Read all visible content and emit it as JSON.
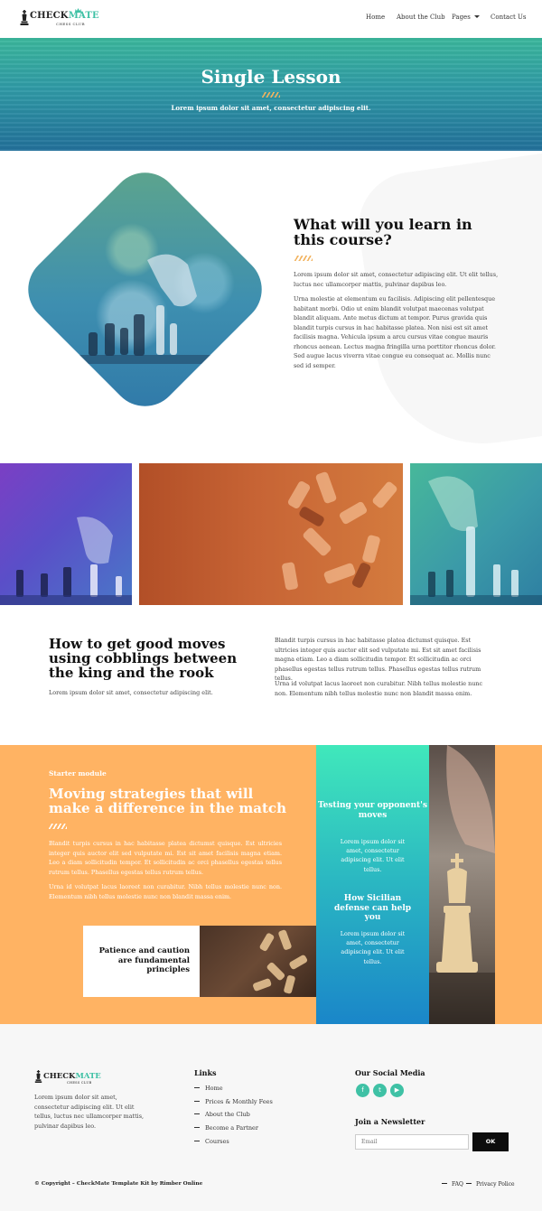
{
  "brand": {
    "name_part1": "CHECK",
    "name_part2": "MATE",
    "tagline": "CHESS CLUB"
  },
  "nav": {
    "items": [
      {
        "label": "Home"
      },
      {
        "label": "About the Club"
      },
      {
        "label": "Pages"
      },
      {
        "label": "Contact Us"
      }
    ]
  },
  "hero": {
    "title": "Single Lesson",
    "subtitle": "Lorem ipsum dolor sit amet, consectetur adipiscing elit."
  },
  "learn": {
    "heading": "What will you learn in this course?",
    "p1": "Lorem ipsum dolor sit amet, consectetur adipiscing elit. Ut elit tellus, luctus nec ullamcorper mattis, pulvinar dapibus leo.",
    "p2": "Urna molestie at elementum eu facilisis. Adipiscing elit pellentesque habitant morbi. Odio ut enim blandit volutpat maecenas volutpat blandit aliquam. Ante metus dictum at tempor. Purus gravida quis blandit turpis cursus in hac habitasse platea. Non nisi est sit amet facilisis magna. Vehicula ipsum a arcu cursus vitae congue mauris rhoncus aenean. Lectus magna fringilla urna porttitor rhoncus dolor. Sed augue lacus viverra vitae congue eu consequat ac. Mollis nunc sed id semper."
  },
  "howto": {
    "heading": "How to get good moves using cobblings between the king and the rook",
    "sub": "Lorem ipsum dolor sit amet, consectetur adipiscing elit.",
    "p1": "Blandit turpis cursus in hac habitasse platea dictumst quisque. Est ultricies integer quis auctor elit sed vulputate mi. Est sit amet facilisis magna etiam. Leo a diam sollicitudin tempor. Et sollicitudin ac orci phasellus egestas tellus rutrum tellus. Phasellus egestas tellus rutrum tellus.",
    "p2": "Urna id volutpat lacus laoreet non curabitur. Nibh tellus molestie nunc non. Elementum nibh tellus molestie nunc non blandit massa enim."
  },
  "module": {
    "kicker": "Starter module",
    "heading": "Moving strategies that will make a difference in the match",
    "p1": "Blandit turpis cursus in hac habitasse platea dictumst quisque. Est ultricies integer quis auctor elit sed vulputate mi. Est sit amet facilisis magna etiam. Leo a diam sollicitudin tempor. Et sollicitudin ac orci phasellus egestas tellus rutrum tellus. Phasellus egestas tellus rutrum tellus.",
    "p2": "Urna id volutpat lacus laoreet non curabitur. Nibh tellus molestie nunc non. Elementum nibh tellus molestie nunc non blandit massa enim.",
    "card": "Patience and caution are fundamental principles",
    "tip1_title": "Testing your opponent's moves",
    "tip1_text": "Lorem ipsum dolor sit amet, consectetur adipiscing elit. Ut elit tellus.",
    "tip2_title": "How Sicilian defense can help you",
    "tip2_text": "Lorem ipsum dolor sit amet, consectetur adipiscing elit. Ut elit tellus."
  },
  "footer": {
    "about": "Lorem ipsum dolor sit amet, consectetur adipiscing elit. Ut elit tellus, luctus nec ullamcorper mattis, pulvinar dapibus leo.",
    "links_title": "Links",
    "links": [
      "Home",
      "Prices & Monthly Fees",
      "About the Club",
      "Become a Partner",
      "Courses"
    ],
    "social_title": "Our Social Media",
    "newsletter_title": "Join a Newsletter",
    "email_placeholder": "Email",
    "ok_label": "OK",
    "copyright": "© Copyright – CheckMate Template Kit by Rimber Online",
    "bottom_links": [
      "FAQ",
      "Privacy Police"
    ]
  },
  "colors": {
    "accent": "#3fc1a5",
    "orange": "#ffb363",
    "gold": "#f2b35f"
  }
}
